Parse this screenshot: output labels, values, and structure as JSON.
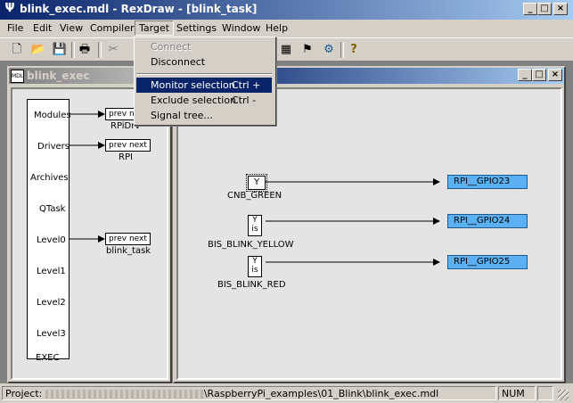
{
  "window": {
    "title": "blink_exec.mdl - RexDraw - [blink_task]"
  },
  "menubar": [
    "File",
    "Edit",
    "View",
    "Compiler",
    "Target",
    "Settings",
    "Window",
    "Help"
  ],
  "target_menu": {
    "items": [
      {
        "label": "Connect",
        "shortcut": "",
        "state": "disabled"
      },
      {
        "label": "Disconnect",
        "shortcut": "",
        "state": "normal"
      },
      {
        "label": "Monitor selection",
        "shortcut": "Ctrl +",
        "state": "highlighted"
      },
      {
        "label": "Exclude selection",
        "shortcut": "Ctrl -",
        "state": "normal"
      },
      {
        "label": "Signal tree...",
        "shortcut": "",
        "state": "normal"
      }
    ]
  },
  "left_window": {
    "title": "blink_exec",
    "exec_block": {
      "name": "EXEC",
      "ports": [
        "Modules",
        "Drivers",
        "Archives",
        "QTask",
        "Level0",
        "Level1",
        "Level2",
        "Level3"
      ]
    },
    "blocks": [
      {
        "port_text": "prev   next",
        "name": "RPiDrv"
      },
      {
        "port_text": "prev   next",
        "name": "RPI"
      },
      {
        "port_text": "prev   next",
        "name": "blink_task"
      }
    ]
  },
  "right_window": {
    "blocks": [
      {
        "name": "CNB_GREEN",
        "ports": [
          "Y"
        ],
        "output_pin": "RPI__GPIO23"
      },
      {
        "name": "BIS_BLINK_YELLOW",
        "ports": [
          "Y",
          "is"
        ],
        "output_pin": "RPI__GPIO24"
      },
      {
        "name": "BIS_BLINK_RED",
        "ports": [
          "Y",
          "is"
        ],
        "output_pin": "RPI__GPIO25"
      }
    ]
  },
  "statusbar": {
    "project_label": "Project:",
    "project_path": "\\RaspberryPi_examples\\01_Blink\\blink_exec.mdl",
    "num": "NUM"
  },
  "colors": {
    "accent": "#0a246a",
    "pin": "#5ab0f0",
    "workspace": "#808080"
  }
}
